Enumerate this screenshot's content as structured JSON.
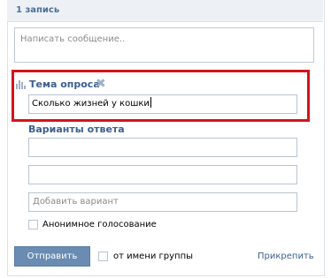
{
  "header": {
    "count_label": "1 запись"
  },
  "compose": {
    "placeholder": "Написать сообщение.."
  },
  "poll": {
    "title": "Тема опроса",
    "close_glyph": "✖",
    "question_value": "Сколько жизней у кошки",
    "answers_title": "Варианты ответа",
    "answer_options": [
      "",
      "",
      ""
    ],
    "add_option_placeholder": "Добавить вариант",
    "anonymous_label": "Анонимное голосование",
    "anonymous_checked": false
  },
  "footer": {
    "send_label": "Отправить",
    "group_label": "от имени группы",
    "group_checked": false,
    "attach_label": "Прикрепить"
  },
  "colors": {
    "accent": "#3b5f8e",
    "button": "#6a8cb3",
    "highlight": "#d4141c",
    "header_bg": "#edf1f5"
  },
  "icons": {
    "poll": "bar-chart-icon",
    "close": "close-icon"
  }
}
